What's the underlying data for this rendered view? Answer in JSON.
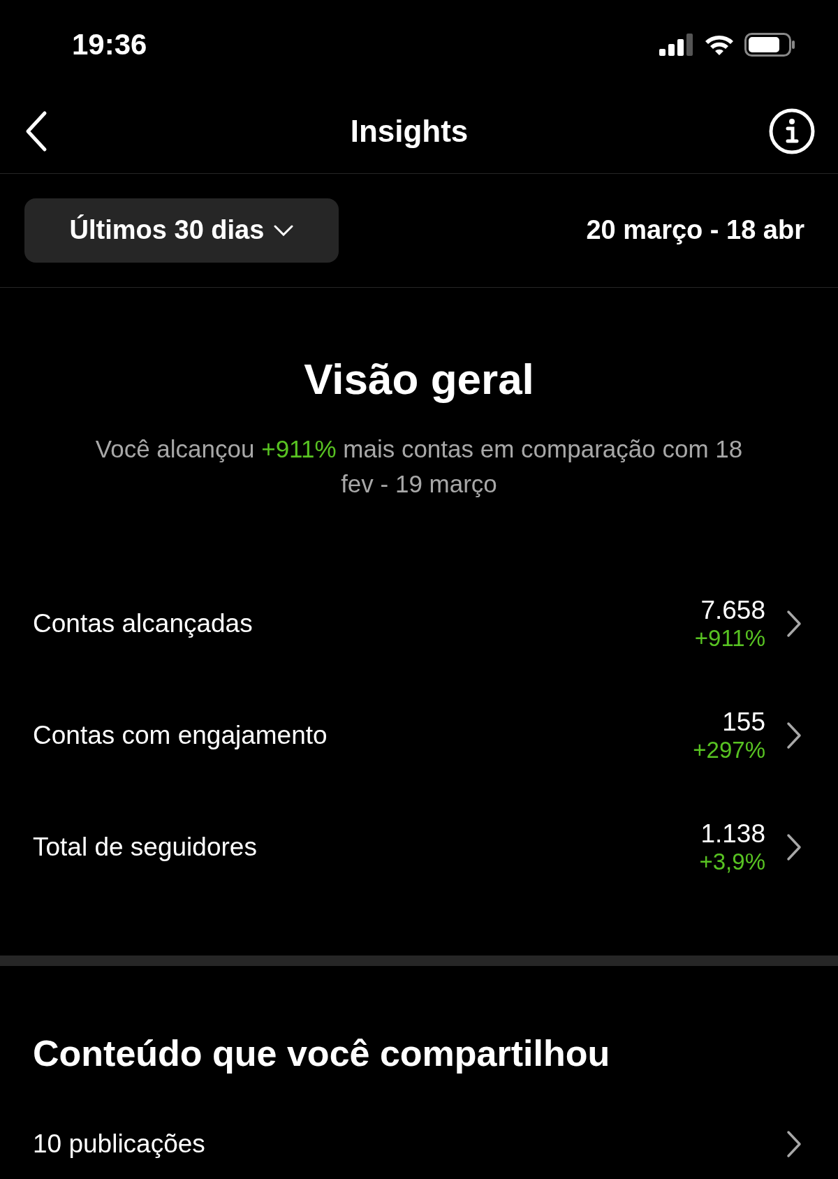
{
  "status_bar": {
    "time": "19:36"
  },
  "header": {
    "title": "Insights"
  },
  "filter": {
    "label": "Últimos 30 dias",
    "date_range": "20 março - 18 abr"
  },
  "overview": {
    "title": "Visão geral",
    "summary": {
      "before": "Você alcançou ",
      "highlight": "+911%",
      "after": " mais contas em comparação com 18 fev - 19 março"
    },
    "metrics": [
      {
        "label": "Contas alcançadas",
        "value": "7.658",
        "change": "+911%"
      },
      {
        "label": "Contas com engajamento",
        "value": "155",
        "change": "+297%"
      },
      {
        "label": "Total de seguidores",
        "value": "1.138",
        "change": "+3,9%"
      }
    ]
  },
  "content": {
    "title": "Conteúdo que você compartilhou",
    "items": [
      {
        "label": "10 publicações"
      }
    ]
  }
}
